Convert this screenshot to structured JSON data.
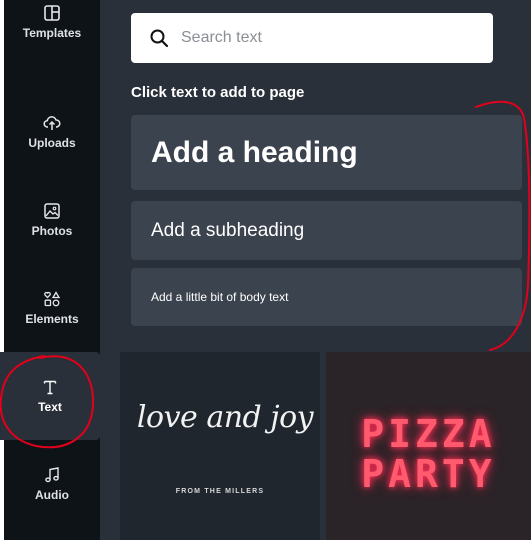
{
  "sidebar": {
    "items": [
      {
        "label": "Templates",
        "icon": "templates-icon"
      },
      {
        "label": "Uploads",
        "icon": "upload-cloud-icon"
      },
      {
        "label": "Photos",
        "icon": "photo-icon"
      },
      {
        "label": "Elements",
        "icon": "shapes-icon"
      },
      {
        "label": "Text",
        "icon": "text-t-icon",
        "active": true
      },
      {
        "label": "Audio",
        "icon": "music-note-icon"
      }
    ]
  },
  "panel": {
    "search": {
      "placeholder": "Search text"
    },
    "section_title": "Click text to add to page",
    "text_options": {
      "heading": "Add a heading",
      "subheading": "Add a subheading",
      "body": "Add a little bit of body text"
    },
    "templates": [
      {
        "script": "love and joy",
        "subtitle": "FROM THE MILLERS"
      },
      {
        "line1": "PIZZA",
        "line2": "PARTY"
      }
    ]
  },
  "colors": {
    "sidebar_bg": "#0e1318",
    "panel_bg": "#293039",
    "card_bg": "#3b434e",
    "annotation_red": "#e3001b",
    "neon_pink": "#ff5a6e"
  }
}
